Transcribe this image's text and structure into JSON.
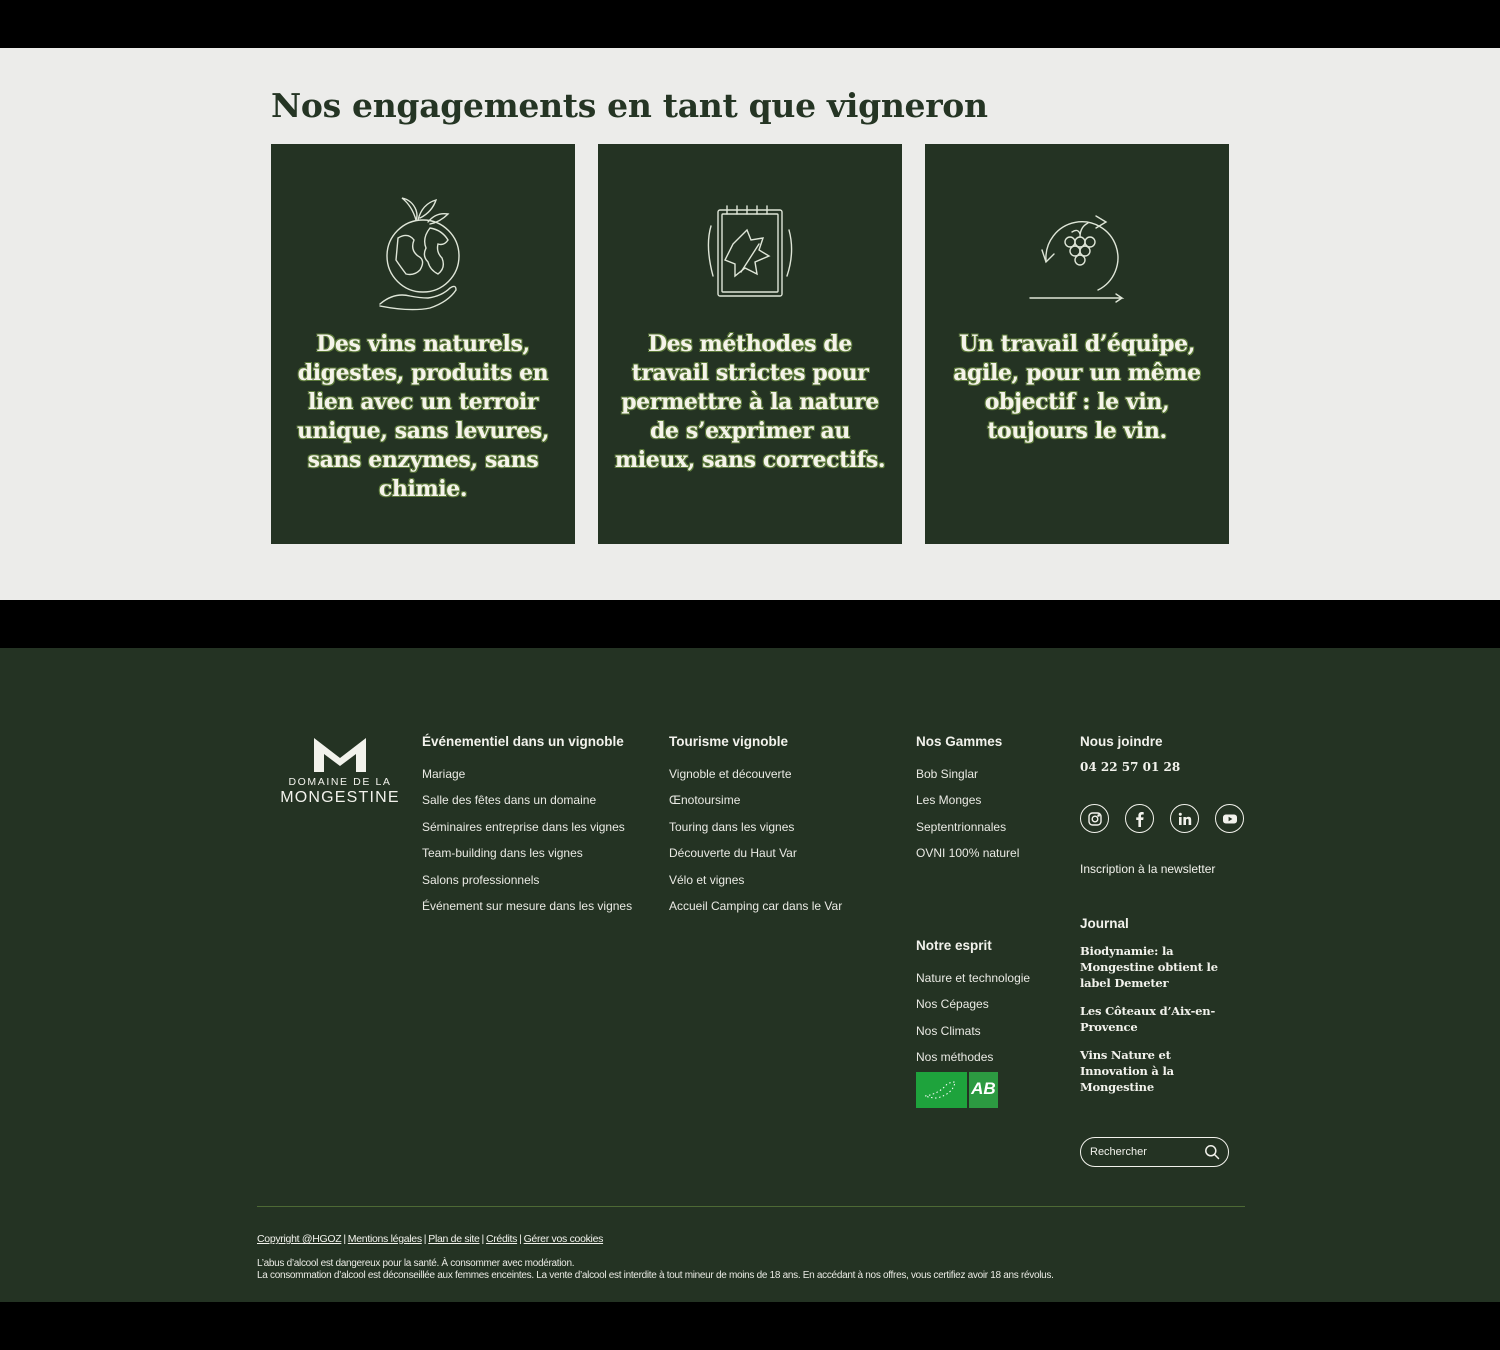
{
  "engagements": {
    "title": "Nos engagements en tant que vigneron",
    "cards": [
      {
        "icon": "earth-in-hand-icon",
        "text": "Des vins naturels, digestes, produits en lien avec un terroir unique, sans levures, sans enzymes, sans chimie."
      },
      {
        "icon": "notebook-leaf-icon",
        "text": "Des méthodes de travail strictes pour permettre à la nature de s’exprimer au mieux, sans correctifs."
      },
      {
        "icon": "grape-cycle-icon",
        "text": "Un travail d’équipe, agile, pour un même objectif : le vin, toujours le vin."
      }
    ]
  },
  "footer": {
    "logo": {
      "top": "DOMAINE DE LA",
      "name": "MONGESTINE"
    },
    "events": {
      "heading": "Événementiel dans un vignoble",
      "items": [
        "Mariage",
        "Salle des fêtes dans un domaine",
        "Séminaires entreprise dans les vignes",
        "Team-building dans les vignes",
        "Salons professionnels",
        "Événement sur mesure dans les vignes"
      ]
    },
    "tourisme": {
      "heading": "Tourisme vignoble",
      "items": [
        "Vignoble et découverte",
        "Œnotoursime",
        "Touring dans les vignes",
        "Découverte du Haut Var",
        "Vélo et vignes",
        "Accueil Camping car dans le Var"
      ]
    },
    "gammes": {
      "heading": "Nos Gammes",
      "items": [
        "Bob Singlar",
        "Les Monges",
        "Septentrionnales",
        "OVNI 100% naturel"
      ]
    },
    "esprit": {
      "heading": "Notre esprit",
      "items": [
        "Nature et technologie",
        "Nos Cépages",
        "Nos Climats",
        "Nos méthodes"
      ]
    },
    "badge": {
      "ab_label": "AB"
    },
    "join": {
      "heading": "Nous joindre",
      "phone": "04 22 57 01 28",
      "socials": [
        "instagram-icon",
        "facebook-icon",
        "linkedin-icon",
        "youtube-icon"
      ],
      "newsletter": "Inscription à la newsletter"
    },
    "journal": {
      "heading": "Journal",
      "items": [
        "Biodynamie: la Mongestine obtient le label Demeter",
        "Les Côteaux d’Aix-en-Provence",
        "Vins Nature et Innovation à la Mongestine"
      ]
    },
    "search": {
      "placeholder": "Rechercher"
    },
    "legal": {
      "links": [
        "Copyright @HGOZ",
        "Mentions légales",
        "Plan de site",
        "Crédits",
        "Gérer vos cookies"
      ],
      "warning_1": "L’abus d’alcool est dangereux pour la santé. À consommer avec modération.",
      "warning_2": "La consommation d’alcool est déconseillée aux femmes enceintes. La vente d’alcool est interdite à tout mineur de moins de 18 ans. En accédant à nos offres, vous certifiez avoir 18 ans révolus."
    }
  },
  "colors": {
    "dark_green": "#243323",
    "light_bg": "#ececea",
    "title_green": "#253524",
    "accent_green": "#4d6a35"
  }
}
